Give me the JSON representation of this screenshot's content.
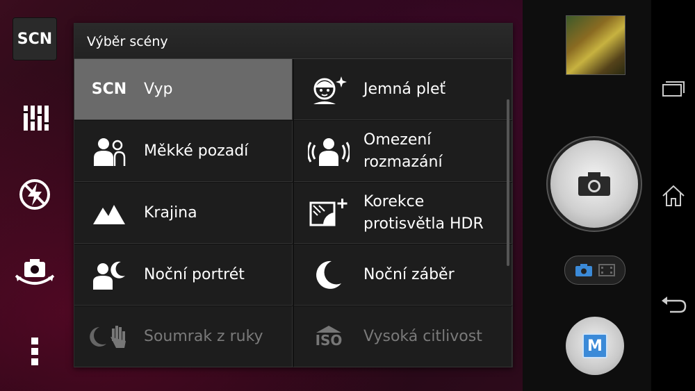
{
  "left_toolbar": {
    "scn_label": "SCN",
    "items": [
      "scene-button",
      "settings-button",
      "flash-button",
      "switch-camera-button",
      "more-button"
    ]
  },
  "dialog": {
    "title": "Výběr scény",
    "scenes": [
      {
        "label": "Vyp",
        "icon": "scn-icon",
        "icon_text": "SCN",
        "selected": true
      },
      {
        "label": "Jemná pleť",
        "icon": "soft-skin-icon"
      },
      {
        "label": "Měkké pozadí",
        "icon": "soft-snap-icon"
      },
      {
        "label": "Omezení rozmazání",
        "icon": "anti-blur-icon"
      },
      {
        "label": "Krajina",
        "icon": "landscape-icon"
      },
      {
        "label": "Korekce protisvětla HDR",
        "icon": "backlight-hdr-icon"
      },
      {
        "label": "Noční portrét",
        "icon": "night-portrait-icon"
      },
      {
        "label": "Noční záběr",
        "icon": "night-scene-icon"
      },
      {
        "label": "Soumrak z ruky",
        "icon": "handheld-twilight-icon",
        "dim": true
      },
      {
        "label": "Vysoká citlivost",
        "icon": "high-sensitivity-icon",
        "icon_text": "ISO",
        "dim": true
      }
    ]
  },
  "right_controls": {
    "mode_label": "M",
    "accent": "#3b8ad8"
  }
}
